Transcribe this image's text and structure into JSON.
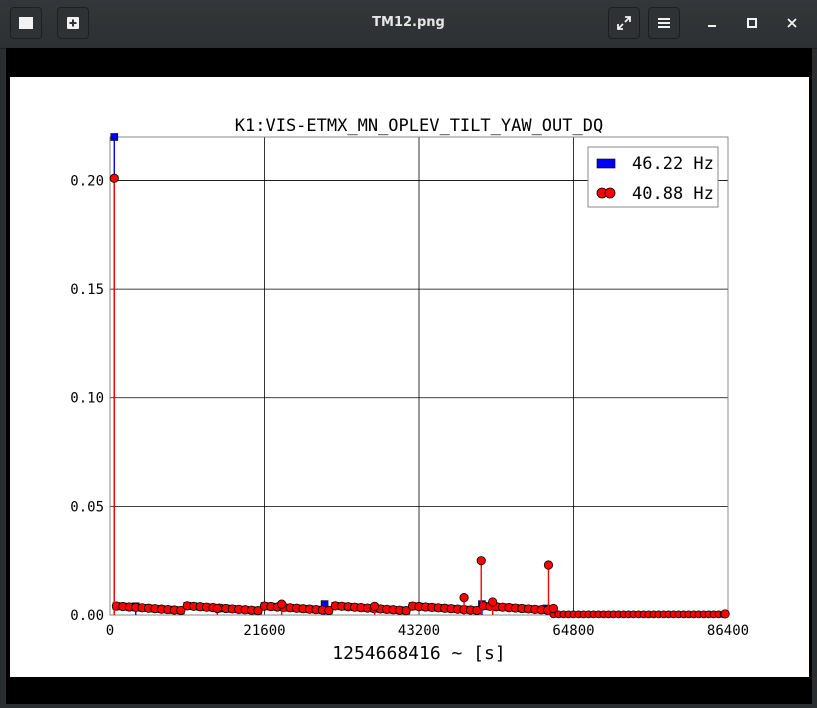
{
  "window": {
    "title": "TM12.png",
    "buttons": {
      "image_menu": "image-icon",
      "new": "new-window-icon",
      "fullscreen": "fullscreen-icon",
      "menu": "hamburger-menu-icon",
      "minimize": "minimize-icon",
      "maximize": "maximize-icon",
      "close": "close-icon"
    }
  },
  "chart_data": {
    "type": "scatter",
    "title": "K1:VIS-ETMX_MN_OPLEV_TILT_YAW_OUT_DQ",
    "xlabel": "1254668416 ~ [s]",
    "ylabel": "",
    "xlim": [
      0,
      86400
    ],
    "ylim": [
      0,
      0.22
    ],
    "x_ticks": [
      "0",
      "21600",
      "43200",
      "64800",
      "86400"
    ],
    "y_ticks": [
      "0.00",
      "0.05",
      "0.10",
      "0.15",
      "0.20"
    ],
    "grid": true,
    "legend_position": "top-right",
    "series": [
      {
        "name": "46.22 Hz",
        "color": "#0000ff",
        "marker": "square",
        "points": [
          [
            600,
            0.22
          ],
          [
            3600,
            0.004
          ],
          [
            30000,
            0.005
          ],
          [
            52000,
            0.005
          ],
          [
            61000,
            0.003
          ]
        ]
      },
      {
        "name": "40.88 Hz",
        "color": "#ff0000",
        "marker": "circle",
        "points": [
          [
            600,
            0.201
          ],
          [
            15000,
            0.003
          ],
          [
            24000,
            0.005
          ],
          [
            37000,
            0.004
          ],
          [
            49500,
            0.008
          ],
          [
            51900,
            0.025
          ],
          [
            53500,
            0.006
          ],
          [
            61300,
            0.023
          ],
          [
            62000,
            0.003
          ],
          [
            86000,
            0.0005
          ]
        ]
      }
    ]
  }
}
